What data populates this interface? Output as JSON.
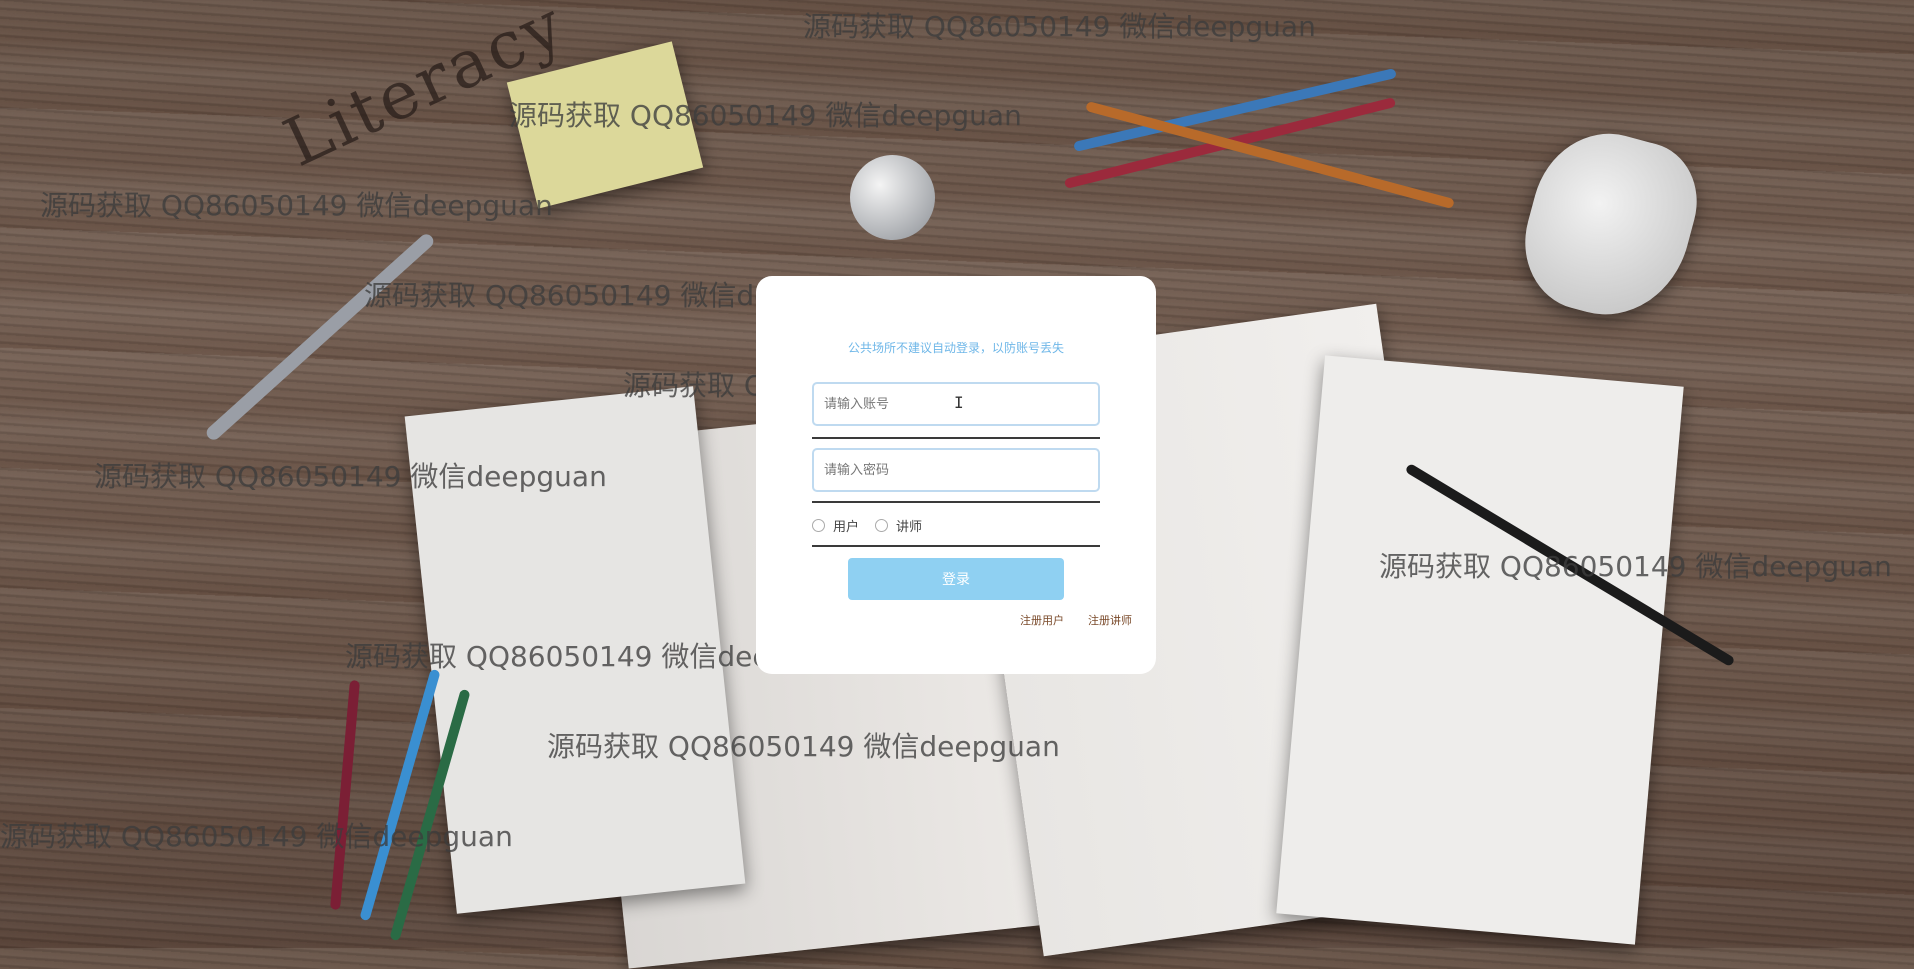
{
  "background": {
    "scene": "wooden-desk-with-books-and-stationery",
    "desk_text": "Literacy"
  },
  "watermarks": [
    "源码获取 QQ86050149 微信deepguan",
    "源码获取 QQ86050149 微信deepguan",
    "源码获取 QQ86050149 微信deepguan",
    "源码获取 QQ86050149 微信deepguan",
    "源码获取 QQ86050149 微信deepguan",
    "源码获取 QQ86050149 微信deepguan",
    "源码获取 QQ86050149 微信deepguan",
    "源码获取 QQ86050149 微信deepguan",
    "源码获取 QQ86050149 微信deepguan",
    "源码获取 QQ86050149 微信deepguan"
  ],
  "login": {
    "notice": "公共场所不建议自动登录，以防账号丢失",
    "username_placeholder": "请输入账号",
    "username_value": "",
    "password_placeholder": "请输入密码",
    "password_value": "",
    "roles": [
      "用户",
      "讲师"
    ],
    "selected_role": "",
    "login_button": "登录",
    "register_user": "注册用户",
    "register_teacher": "注册讲师"
  },
  "colors": {
    "notice": "#6fb7e8",
    "button": "#8fd0f2",
    "input_border": "#bfdaf0",
    "register_link": "#7a4a2a"
  }
}
